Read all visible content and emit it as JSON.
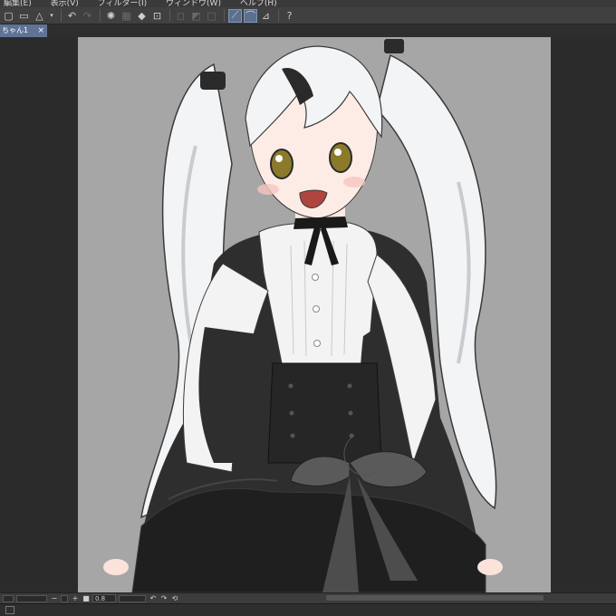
{
  "menubar": {
    "items": [
      "編集(E)",
      "表示(V)",
      "フィルター(I)",
      "ウィンドウ(W)",
      "ヘルプ(H)"
    ]
  },
  "toolbar": {
    "icons": [
      "new-file-icon",
      "open-folder-icon",
      "save-icon",
      "undo-icon",
      "redo-icon",
      "loading-icon",
      "clear-icon",
      "fill-icon",
      "transform-icon",
      "select-icon",
      "snap-ruler-icon",
      "snap-special-ruler-icon",
      "snap-grid-icon",
      "help-icon"
    ]
  },
  "document_tab": {
    "title": "ちゃん1",
    "close": "×"
  },
  "statusbar": {
    "zoom_out": "−",
    "zoom_in": "+",
    "zoom_value": "0.8",
    "rotate_left": "↶",
    "rotate_right": "↷",
    "reset": "⟲"
  },
  "colors": {
    "canvas_bg": "#a6a6a6",
    "active_tab": "#5f7396",
    "hair": "#f2f4f6",
    "dress": "#2e2e2e",
    "eye": "#8b7a2a"
  }
}
